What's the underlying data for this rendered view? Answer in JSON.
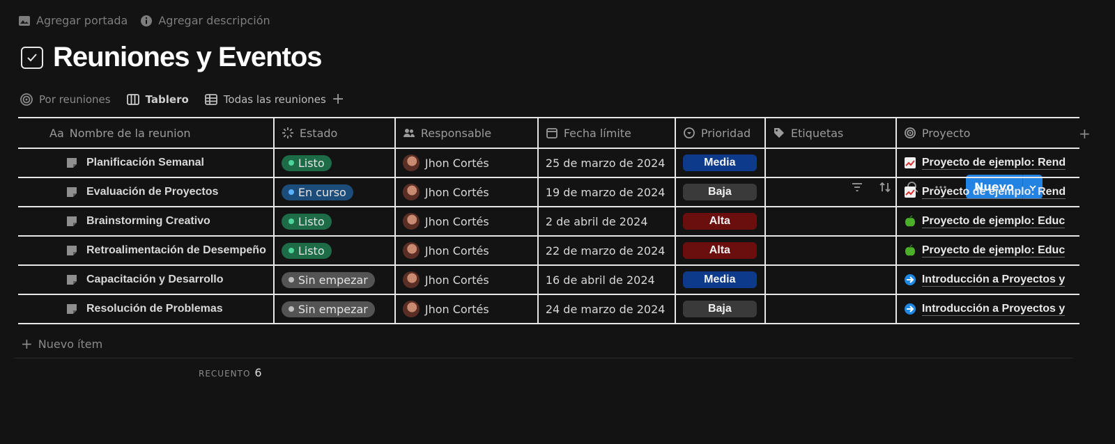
{
  "topbar": {
    "add_cover": "Agregar portada",
    "add_description": "Agregar descripción"
  },
  "page": {
    "title": "Reuniones y Eventos"
  },
  "views": [
    {
      "label": "Por reuniones",
      "icon": "target-icon"
    },
    {
      "label": "Tablero",
      "icon": "board-icon"
    },
    {
      "label": "Todas las reuniones",
      "icon": "table-icon"
    }
  ],
  "toolbar": {
    "new_label": "Nuevo"
  },
  "columns": {
    "name": "Nombre de la reunion",
    "name_prefix": "Aa",
    "estado": "Estado",
    "responsable": "Responsable",
    "fecha": "Fecha límite",
    "prioridad": "Prioridad",
    "etiquetas": "Etiquetas",
    "proyecto": "Proyecto"
  },
  "rows": [
    {
      "name": "Planificación Semanal",
      "estado": "Listo",
      "estado_kind": "listo",
      "responsable": "Jhon Cortés",
      "fecha": "25 de marzo de 2024",
      "prioridad": "Media",
      "prio_kind": "media",
      "etiquetas": "",
      "proyecto": "Proyecto de ejemplo: Rend",
      "proj_icon": "chart-icon"
    },
    {
      "name": "Evaluación de Proyectos",
      "estado": "En curso",
      "estado_kind": "curso",
      "responsable": "Jhon Cortés",
      "fecha": "19 de marzo de 2024",
      "prioridad": "Baja",
      "prio_kind": "baja",
      "etiquetas": "",
      "proyecto": "Proyecto de ejemplo: Rend",
      "proj_icon": "chart-icon"
    },
    {
      "name": "Brainstorming Creativo",
      "estado": "Listo",
      "estado_kind": "listo",
      "responsable": "Jhon Cortés",
      "fecha": "2 de abril de 2024",
      "prioridad": "Alta",
      "prio_kind": "alta",
      "etiquetas": "",
      "proyecto": "Proyecto de ejemplo: Educ",
      "proj_icon": "apple-icon"
    },
    {
      "name": "Retroalimentación de Desempeño",
      "estado": "Listo",
      "estado_kind": "listo",
      "responsable": "Jhon Cortés",
      "fecha": "22 de marzo de 2024",
      "prioridad": "Alta",
      "prio_kind": "alta",
      "etiquetas": "",
      "proyecto": "Proyecto de ejemplo: Educ",
      "proj_icon": "apple-icon"
    },
    {
      "name": "Capacitación y Desarrollo",
      "estado": "Sin empezar",
      "estado_kind": "sin",
      "responsable": "Jhon Cortés",
      "fecha": "16 de abril de 2024",
      "prioridad": "Media",
      "prio_kind": "media",
      "etiquetas": "",
      "proyecto": "Introducción a Proyectos y",
      "proj_icon": "arrow-icon"
    },
    {
      "name": "Resolución de Problemas",
      "estado": "Sin empezar",
      "estado_kind": "sin",
      "responsable": "Jhon Cortés",
      "fecha": "24 de marzo de 2024",
      "prioridad": "Baja",
      "prio_kind": "baja",
      "etiquetas": "",
      "proyecto": "Introducción a Proyectos y",
      "proj_icon": "arrow-icon"
    }
  ],
  "footer": {
    "new_item": "Nuevo ítem",
    "count_label": "RECUENTO",
    "count_value": "6"
  },
  "colors": {
    "accent": "#2383e2",
    "listo": "#1e6b47",
    "en_curso": "#1c4c7a",
    "sin_empezar": "#545454",
    "media": "#0d3a8a",
    "baja": "#3a3a3a",
    "alta": "#6b0e0e"
  }
}
